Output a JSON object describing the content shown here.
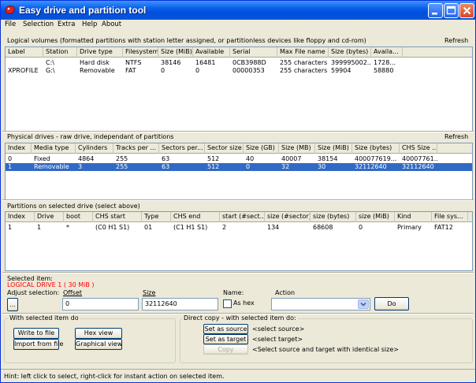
{
  "window": {
    "title": "Easy drive and partition tool"
  },
  "menu": [
    "File",
    "Selection",
    "Extra",
    "Help",
    "About"
  ],
  "logical": {
    "title": "Logical volumes (formatted partitions with station letter assigned, or partitionless devices like floppy and cd-rom)",
    "refresh": "Refresh",
    "columns": [
      "Label",
      "Station",
      "Drive type",
      "Filesystem",
      "Size (MiB)",
      "Available",
      "Serial",
      "Max File name",
      "Size (bytes)",
      "Availa..."
    ],
    "rows": [
      [
        "",
        "C:\\",
        "Hard disk",
        "NTFS",
        "38146",
        "16481",
        "0CB3988D",
        "255 characters",
        "399995002...",
        "1728..."
      ],
      [
        "XPROFILE",
        "G:\\",
        "Removable",
        "FAT",
        "0",
        "0",
        "00000353",
        "255 characters",
        "59904",
        "58880"
      ]
    ]
  },
  "physical": {
    "title": "Physical drives - raw drive, independant of partitions",
    "refresh": "Refresh",
    "columns": [
      "Index",
      "Media type",
      "Cylinders",
      "Tracks per ...",
      "Sectors per...",
      "Sector size",
      "Size (GB)",
      "Size (MB)",
      "Size (MiB)",
      "Size (bytes)",
      "CHS Size ..."
    ],
    "rows": [
      [
        "0",
        "Fixed",
        "4864",
        "255",
        "63",
        "512",
        "40",
        "40007",
        "38154",
        "400077619...",
        "40007761..."
      ],
      [
        "1",
        "Removable",
        "3",
        "255",
        "63",
        "512",
        "0",
        "32",
        "30",
        "32112640",
        "32112640"
      ]
    ],
    "selected_row": 1
  },
  "partitions": {
    "title": "Partitions on selected drive (select above)",
    "columns": [
      "Index",
      "Drive",
      "boot",
      "CHS start",
      "Type",
      "CHS end",
      "start (#sect...",
      "size (#sector)",
      "size (bytes)",
      "size (MiB)",
      "Kind",
      "File sys..."
    ],
    "rows": [
      [
        "1",
        "1",
        "*",
        "(C0 H1 S1)",
        "01",
        "(C1 H1 S1)",
        "2",
        "134",
        "68608",
        "0",
        "Primary",
        "FAT12"
      ]
    ]
  },
  "selection": {
    "heading": "Selected item:",
    "item": "LOGICAL DRIVE 1   ( 30 MiB )",
    "adjust_label": "Adjust selection:",
    "offset_label": "Offset",
    "size_label": "Size",
    "name_label": "Name:",
    "action_label": "Action",
    "browse_button": "...",
    "offset_value": "0",
    "size_value": "32112640",
    "as_hex_label": "As hex",
    "action_value": "",
    "do_button": "Do"
  },
  "with_selected": {
    "title": "With selected item do",
    "write_to_file": "Write to file",
    "hex_view": "Hex view",
    "import_from_file": "Import from file",
    "graphical_view": "Graphical view"
  },
  "direct_copy": {
    "title": "Direct copy - with selected item do:",
    "set_source": "Set as source",
    "source_value": "<select source>",
    "set_target": "Set as target",
    "target_value": "<select target>",
    "copy": "Copy",
    "copy_hint": "<Select source and target with identical size>"
  },
  "status": {
    "hint": "Hint: left click to select, right-click for instant action on selected item."
  },
  "colors": {
    "titlebar": "#0a5ee8",
    "selection": "#316ac5",
    "selected_item_text": "#ff0000"
  }
}
